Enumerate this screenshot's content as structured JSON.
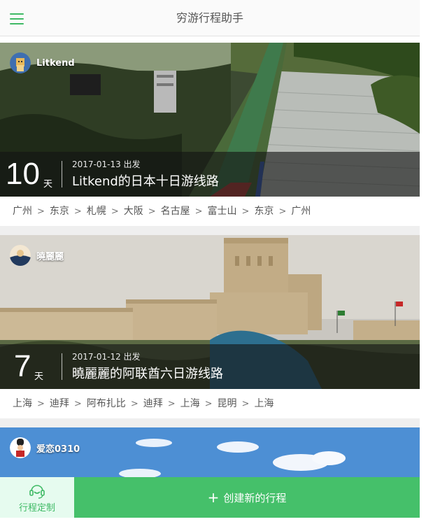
{
  "header": {
    "title": "穷游行程助手",
    "menu_icon": "hamburger-menu-icon"
  },
  "trips": [
    {
      "username": "Litkend",
      "days": "10",
      "days_unit": "天",
      "start": "2017-01-13 出发",
      "title": "Litkend的日本十日游线路",
      "route": [
        "广州",
        "东京",
        "札幌",
        "大阪",
        "名古屋",
        "富士山",
        "东京",
        "广州"
      ]
    },
    {
      "username": "曉麗麗",
      "days": "7",
      "days_unit": "天",
      "start": "2017-01-12 出发",
      "title": "曉麗麗的阿联酋六日游线路",
      "route": [
        "上海",
        "迪拜",
        "阿布扎比",
        "迪拜",
        "上海",
        "昆明",
        "上海"
      ]
    },
    {
      "username": "爱恋0310"
    }
  ],
  "bottom": {
    "custom_label": "行程定制",
    "create_label": "创建新的行程"
  },
  "colors": {
    "accent": "#45c06a",
    "accent_light": "#e6fbef"
  }
}
